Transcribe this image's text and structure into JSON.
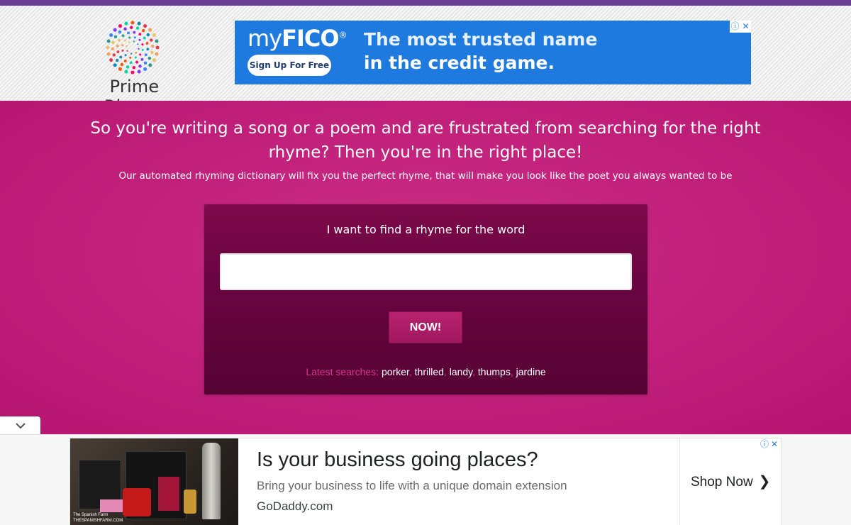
{
  "logo": {
    "text": "Prime Rhyme",
    "icon": "dotted-spiral-logo"
  },
  "top_ad": {
    "brand_main": "my",
    "brand_bold": "FICO",
    "brand_reg": "®",
    "cta": "Sign Up For Free",
    "tagline_line1": "The most trusted name",
    "tagline_line2": "in the credit game.",
    "adchoices_info": "ⓘ",
    "adchoices_close": "✕",
    "background_color": "#1f7ae0"
  },
  "hero": {
    "headline": "So you're writing a song or a poem and are frustrated from searching for the right rhyme? Then you're in the right place!",
    "subline": "Our automated rhyming dictionary will fix you the perfect rhyme, that will make you look like the poet you always wanted to be"
  },
  "search": {
    "label": "I want to find a rhyme for the word",
    "value": "",
    "placeholder": "",
    "button": "NOW!",
    "latest_label": "Latest searches:",
    "latest": [
      "porker",
      "thrilled",
      "landy",
      "thumps",
      "jardine"
    ]
  },
  "collapse_tab": {
    "icon": "chevron-down-icon",
    "glyph": "⌄"
  },
  "bottom_ad": {
    "image_credit_line1": "The Spanish Farm",
    "image_credit_line2": "THESPANISHFARM.COM",
    "title": "Is your business going places?",
    "description": "Bring your business to life with a unique domain extension",
    "domain": "GoDaddy.com",
    "cta": "Shop Now",
    "cta_chevron": "❯",
    "adchoices_info": "ⓘ",
    "adchoices_close": "✕"
  },
  "colors": {
    "topbar": "#6a3f93",
    "hero_bg": "#c01f7a",
    "search_panel": "#6a0541",
    "button": "#b9216f",
    "latest_label": "#d3358e"
  }
}
